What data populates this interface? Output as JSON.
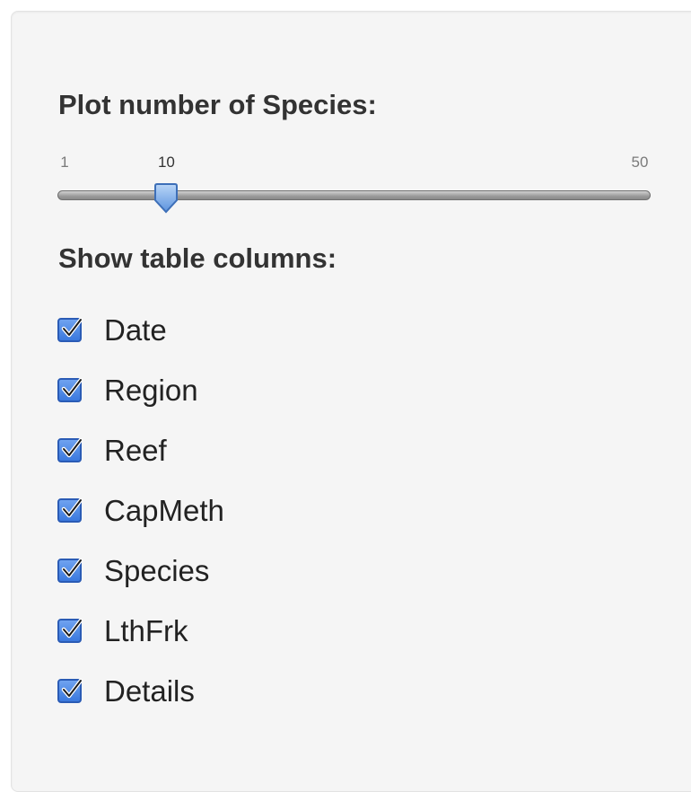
{
  "slider": {
    "label": "Plot number of Species:",
    "min": 1,
    "max": 50,
    "value": 10,
    "min_label": "1",
    "max_label": "50",
    "value_label": "10"
  },
  "columns": {
    "label": "Show table columns:",
    "options": [
      {
        "label": "Date",
        "checked": true
      },
      {
        "label": "Region",
        "checked": true
      },
      {
        "label": "Reef",
        "checked": true
      },
      {
        "label": "CapMeth",
        "checked": true
      },
      {
        "label": "Species",
        "checked": true
      },
      {
        "label": "LthFrk",
        "checked": true
      },
      {
        "label": "Details",
        "checked": true
      }
    ]
  },
  "colors": {
    "panel_bg": "#f5f5f5",
    "checkbox_accent": "#3a78dd",
    "handle_fill": "#7aaee8"
  }
}
